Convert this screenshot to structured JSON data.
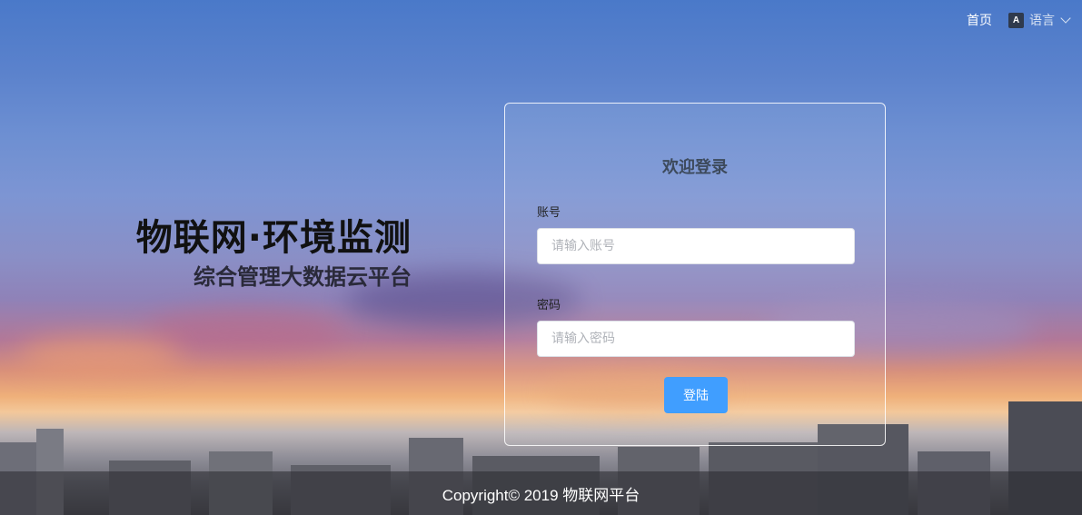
{
  "nav": {
    "home_label": "首页",
    "language_label": "语言",
    "language_icon_text": "A"
  },
  "brand": {
    "title": "物联网·环境监测",
    "subtitle": "综合管理大数据云平台"
  },
  "login": {
    "title": "欢迎登录",
    "account_label": "账号",
    "account_placeholder": "请输入账号",
    "password_label": "密码",
    "password_placeholder": "请输入密码",
    "submit_label": "登陆"
  },
  "footer": {
    "copyright": "Copyright© 2019 物联网平台"
  }
}
